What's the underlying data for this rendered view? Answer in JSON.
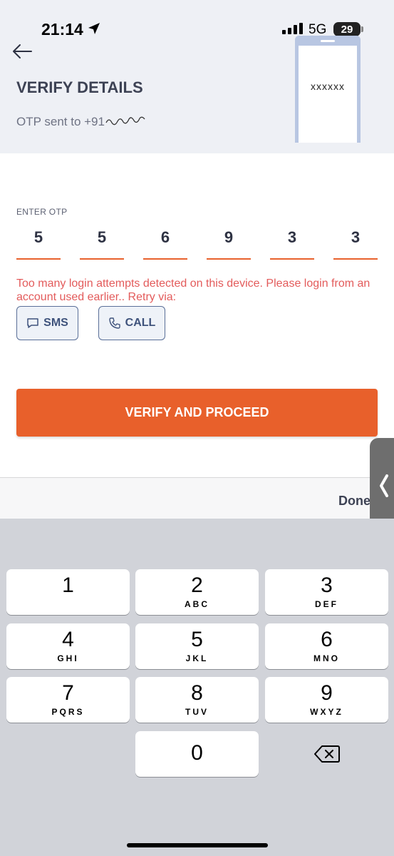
{
  "status_bar": {
    "time": "21:14",
    "network": "5G",
    "battery": "29"
  },
  "header": {
    "title": "VERIFY DETAILS",
    "otp_sent_text": "OTP sent to +91",
    "phone_masked": "xxxxxx"
  },
  "otp": {
    "label": "ENTER OTP",
    "digits": [
      "5",
      "5",
      "6",
      "9",
      "3",
      "3"
    ]
  },
  "error": {
    "message": "Too many login attempts detected on this device. Please login from an account used earlier.. Retry via:"
  },
  "retry": {
    "sms_label": "SMS",
    "call_label": "CALL"
  },
  "verify_button": {
    "label": "VERIFY AND PROCEED"
  },
  "accessory": {
    "done_label": "Done"
  },
  "keypad": {
    "keys": [
      {
        "num": "1",
        "letters": ""
      },
      {
        "num": "2",
        "letters": "ABC"
      },
      {
        "num": "3",
        "letters": "DEF"
      },
      {
        "num": "4",
        "letters": "GHI"
      },
      {
        "num": "5",
        "letters": "JKL"
      },
      {
        "num": "6",
        "letters": "MNO"
      },
      {
        "num": "7",
        "letters": "PQRS"
      },
      {
        "num": "8",
        "letters": "TUV"
      },
      {
        "num": "9",
        "letters": "WXYZ"
      },
      {
        "num": "0",
        "letters": ""
      }
    ]
  },
  "colors": {
    "accent": "#e8602b",
    "error": "#e35b5b",
    "header_bg": "#eef0f5",
    "keyboard_bg": "#d1d3d9"
  }
}
